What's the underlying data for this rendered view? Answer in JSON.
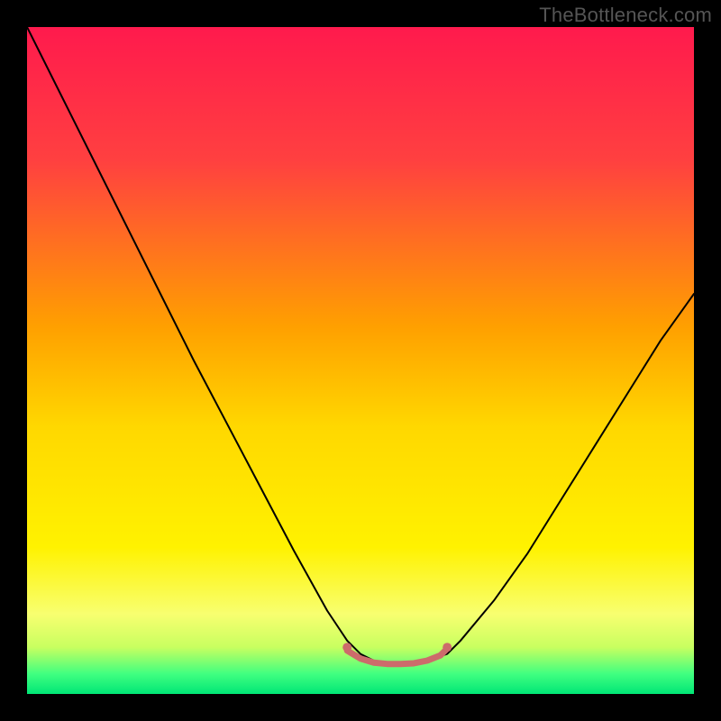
{
  "watermark": "TheBottleneck.com",
  "chart_data": {
    "type": "line",
    "title": "",
    "xlabel": "",
    "ylabel": "",
    "xlim": [
      0,
      100
    ],
    "ylim": [
      0,
      100
    ],
    "gradient_stops": [
      {
        "pos": 0.0,
        "color": "#ff1a4d"
      },
      {
        "pos": 0.2,
        "color": "#ff4040"
      },
      {
        "pos": 0.45,
        "color": "#ffa000"
      },
      {
        "pos": 0.6,
        "color": "#ffd800"
      },
      {
        "pos": 0.78,
        "color": "#fff200"
      },
      {
        "pos": 0.88,
        "color": "#f8ff70"
      },
      {
        "pos": 0.93,
        "color": "#c8ff60"
      },
      {
        "pos": 0.97,
        "color": "#40ff80"
      },
      {
        "pos": 1.0,
        "color": "#00e676"
      }
    ],
    "series": [
      {
        "name": "bottleneck-curve",
        "color": "#000000",
        "width": 2,
        "x": [
          0,
          5,
          10,
          15,
          20,
          25,
          30,
          35,
          40,
          45,
          48,
          50,
          52,
          55,
          58,
          60,
          63,
          65,
          70,
          75,
          80,
          85,
          90,
          95,
          100
        ],
        "values": [
          100,
          90,
          80,
          70,
          60,
          50,
          40.5,
          31,
          21.5,
          12.5,
          8,
          6,
          5,
          4.5,
          4.5,
          5,
          6,
          8,
          14,
          21,
          29,
          37,
          45,
          53,
          60
        ]
      },
      {
        "name": "optimal-band",
        "color": "#cc6b6b",
        "width": 7,
        "x": [
          48,
          50,
          52,
          54,
          56,
          58,
          60,
          62,
          63
        ],
        "values": [
          6.5,
          5.3,
          4.7,
          4.5,
          4.5,
          4.6,
          5.0,
          5.8,
          6.8
        ]
      }
    ],
    "markers": [
      {
        "name": "band-left-dot",
        "x": 48,
        "y": 7.0,
        "r": 5,
        "color": "#cc6b6b"
      },
      {
        "name": "band-right-dot",
        "x": 63,
        "y": 7.0,
        "r": 5,
        "color": "#cc6b6b"
      }
    ]
  }
}
